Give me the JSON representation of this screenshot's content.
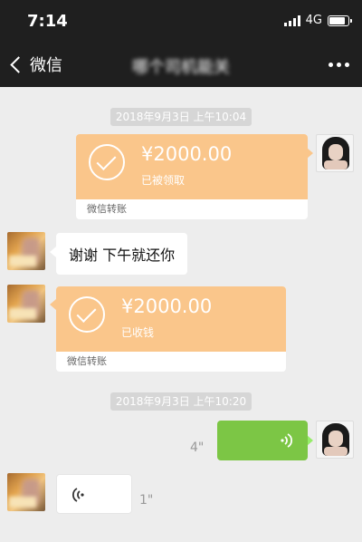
{
  "status": {
    "time": "7:14",
    "network": "4G"
  },
  "nav": {
    "back_label": "微信",
    "title": "哪个司机能关"
  },
  "messages": {
    "time1": "2018年9月3日 上午10:04",
    "transfer1": {
      "amount": "¥2000.00",
      "status": "已被领取",
      "footer": "微信转账"
    },
    "text1": "谢谢 下午就还你",
    "transfer2": {
      "amount": "¥2000.00",
      "status": "已收钱",
      "footer": "微信转账"
    },
    "time2": "2018年9月3日 上午10:20",
    "voice_out": {
      "duration": "4\""
    },
    "voice_in": {
      "duration": "1\""
    }
  },
  "colors": {
    "transfer": "#fac68b",
    "voice_out": "#7cc645",
    "navbar": "#1f1f1f",
    "background": "#ededed"
  }
}
